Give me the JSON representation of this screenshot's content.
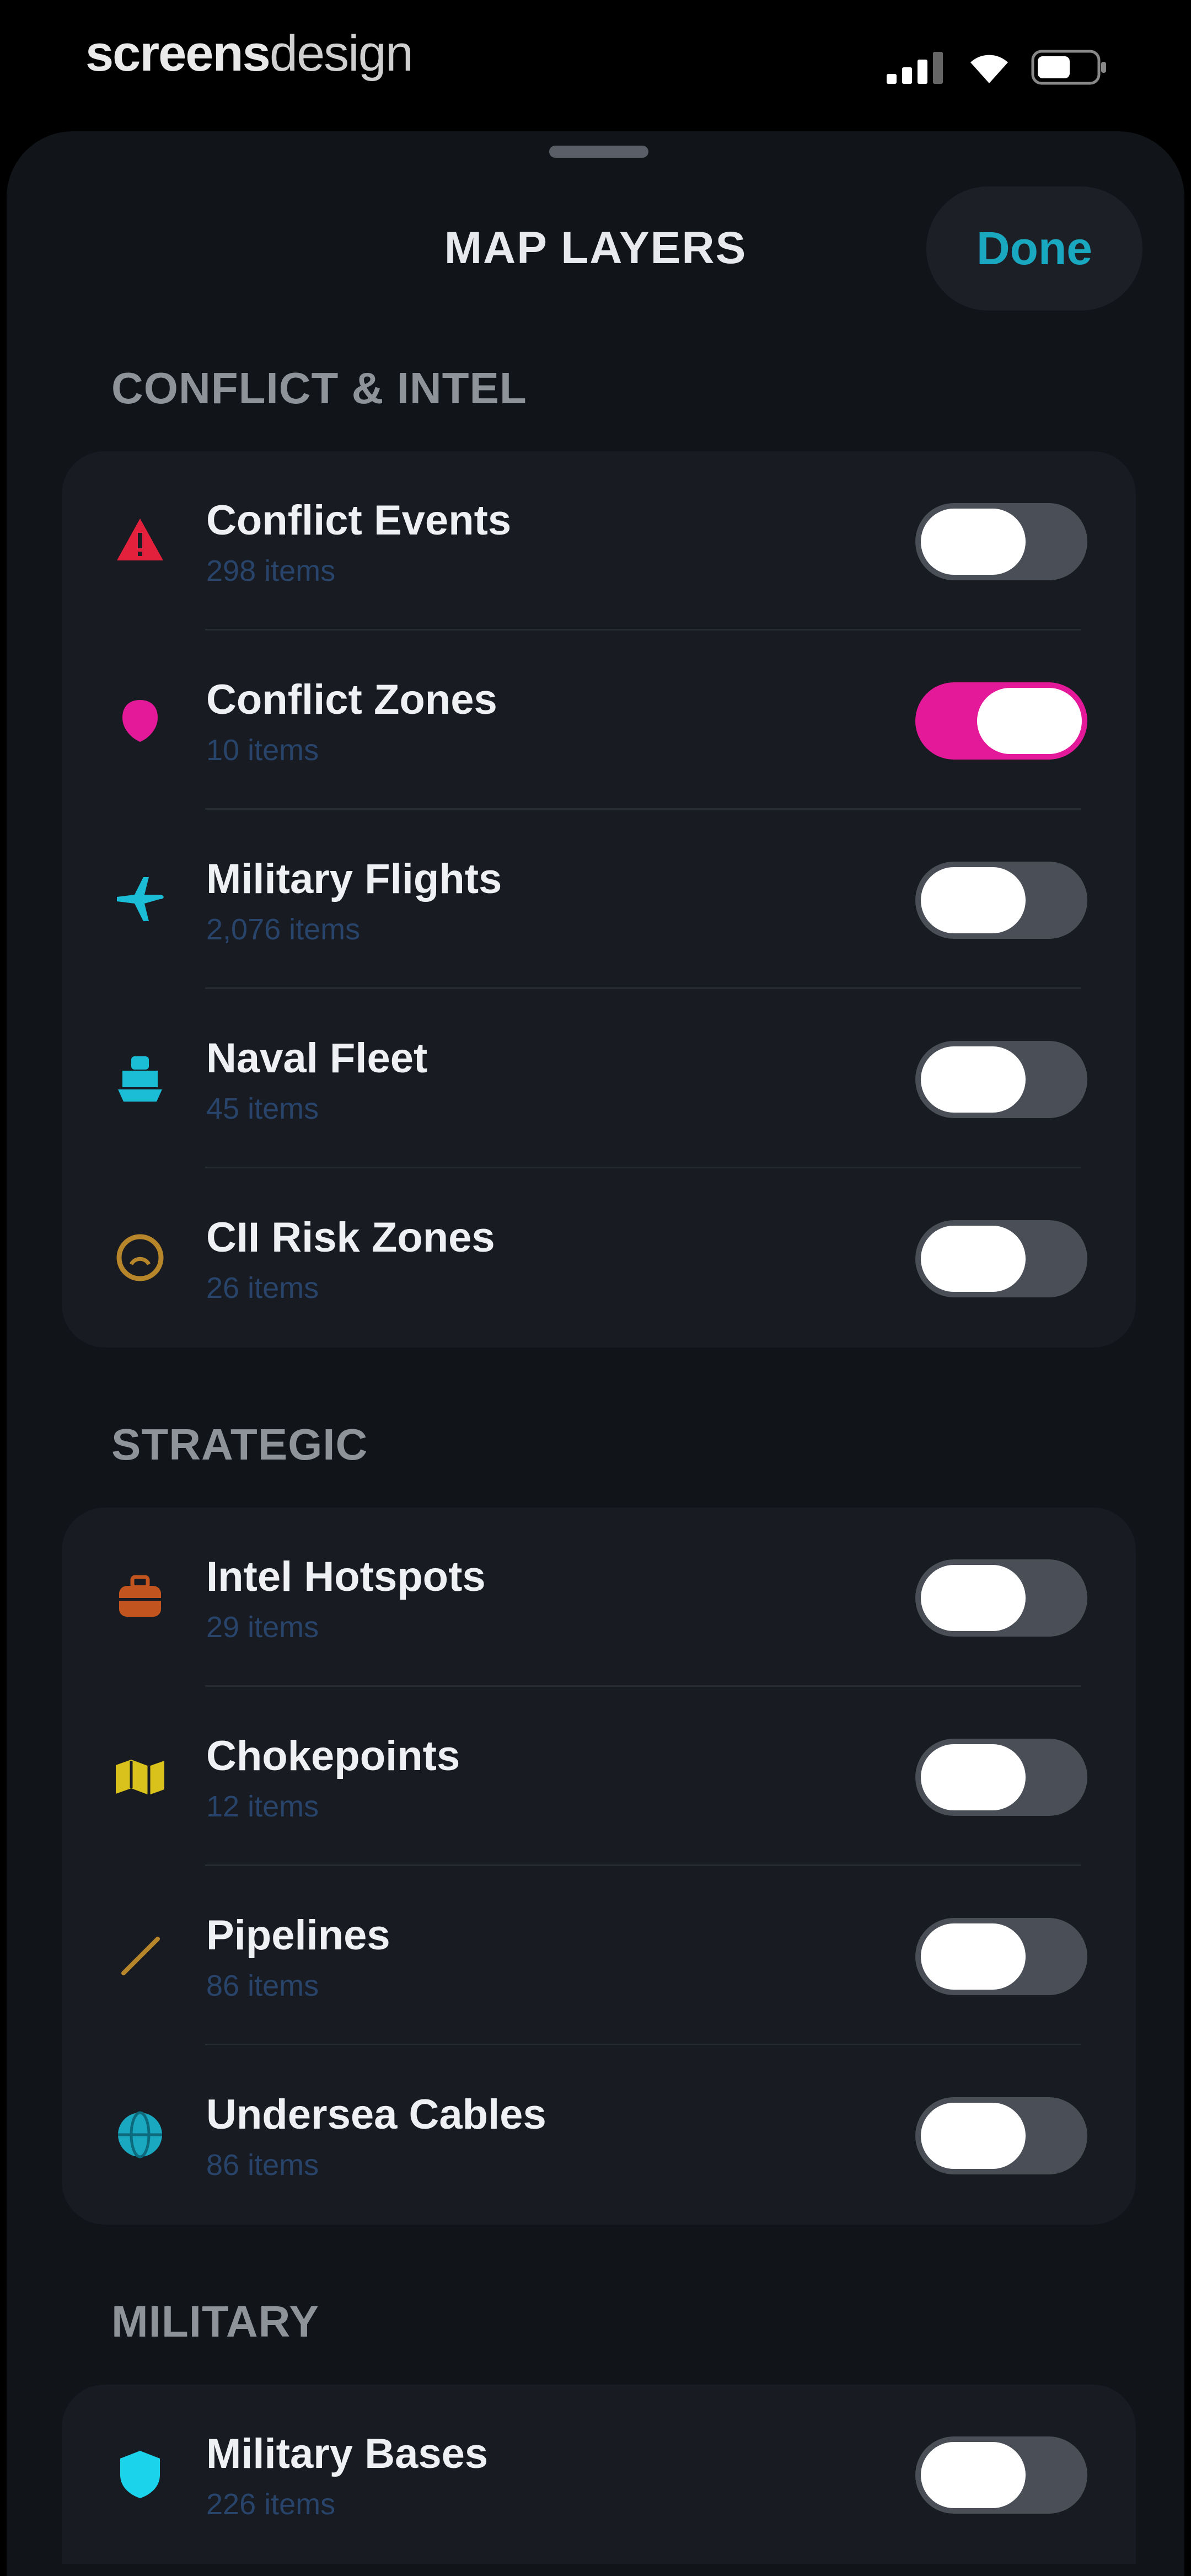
{
  "status_bar": {
    "brand_bold": "screens",
    "brand_light": "design"
  },
  "sheet": {
    "title": "MAP LAYERS",
    "done_label": "Done"
  },
  "sections": [
    {
      "title": "CONFLICT & INTEL",
      "rows": [
        {
          "name": "Conflict Events",
          "count": "298 items",
          "icon": "warning-triangle-icon",
          "color": "#e3213c",
          "enabled": false
        },
        {
          "name": "Conflict Zones",
          "count": "10 items",
          "icon": "zone-marker-icon",
          "color": "#e3199a",
          "enabled": true
        },
        {
          "name": "Military Flights",
          "count": "2,076 items",
          "icon": "airplane-icon",
          "color": "#1bbcd6",
          "enabled": false
        },
        {
          "name": "Naval Fleet",
          "count": "45 items",
          "icon": "ship-icon",
          "color": "#1bbcd6",
          "enabled": false
        },
        {
          "name": "CII Risk Zones",
          "count": "26 items",
          "icon": "gauge-icon",
          "color": "#b8862a",
          "enabled": false
        }
      ]
    },
    {
      "title": "STRATEGIC",
      "rows": [
        {
          "name": "Intel Hotspots",
          "count": "29 items",
          "icon": "briefcase-icon",
          "color": "#c2551f",
          "enabled": false
        },
        {
          "name": "Chokepoints",
          "count": "12 items",
          "icon": "map-icon",
          "color": "#d9c21c",
          "enabled": false
        },
        {
          "name": "Pipelines",
          "count": "86 items",
          "icon": "pipeline-icon",
          "color": "#b8862a",
          "enabled": false
        },
        {
          "name": "Undersea Cables",
          "count": "86 items",
          "icon": "globe-icon",
          "color": "#1aa7c0",
          "enabled": false
        }
      ]
    },
    {
      "title": "MILITARY",
      "rows": [
        {
          "name": "Military Bases",
          "count": "226 items",
          "icon": "shield-icon",
          "color": "#1bd3ea",
          "enabled": false
        }
      ]
    }
  ]
}
